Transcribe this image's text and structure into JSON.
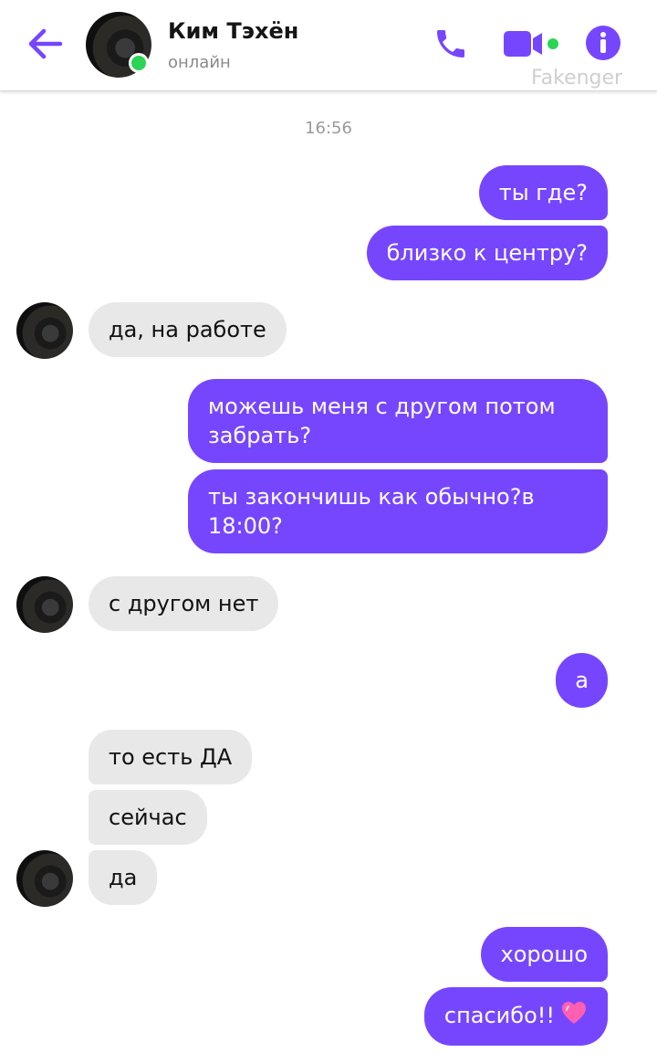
{
  "header": {
    "contact_name": "Ким Тэхён",
    "status": "онлайн",
    "watermark": "Fakenger",
    "accent_color": "#7646ff",
    "icons": [
      "back-arrow-icon",
      "phone-icon",
      "video-camera-icon",
      "info-icon"
    ]
  },
  "chat": {
    "time_separator": "16:56",
    "messages": [
      {
        "dir": "out",
        "text": "ты где?"
      },
      {
        "dir": "out",
        "text": "близко к центру?"
      },
      {
        "dir": "in",
        "text": "да, на работе"
      },
      {
        "dir": "out",
        "text": "можешь меня с другом потом забрать?"
      },
      {
        "dir": "out",
        "text": "ты закончишь как обычно?в 18:00?"
      },
      {
        "dir": "in",
        "text": "с другом нет"
      },
      {
        "dir": "out",
        "text": "а"
      },
      {
        "dir": "in",
        "text": "то есть ДА"
      },
      {
        "dir": "in",
        "text": "сейчас"
      },
      {
        "dir": "in",
        "text": "да"
      },
      {
        "dir": "out",
        "text": "хорошо"
      },
      {
        "dir": "out",
        "text": "спасибо!!",
        "emoji": "heart-icon"
      }
    ]
  },
  "colors": {
    "outgoing_bubble": "#7646ff",
    "incoming_bubble": "#e8e8e8",
    "online_indicator": "#2bd454"
  }
}
